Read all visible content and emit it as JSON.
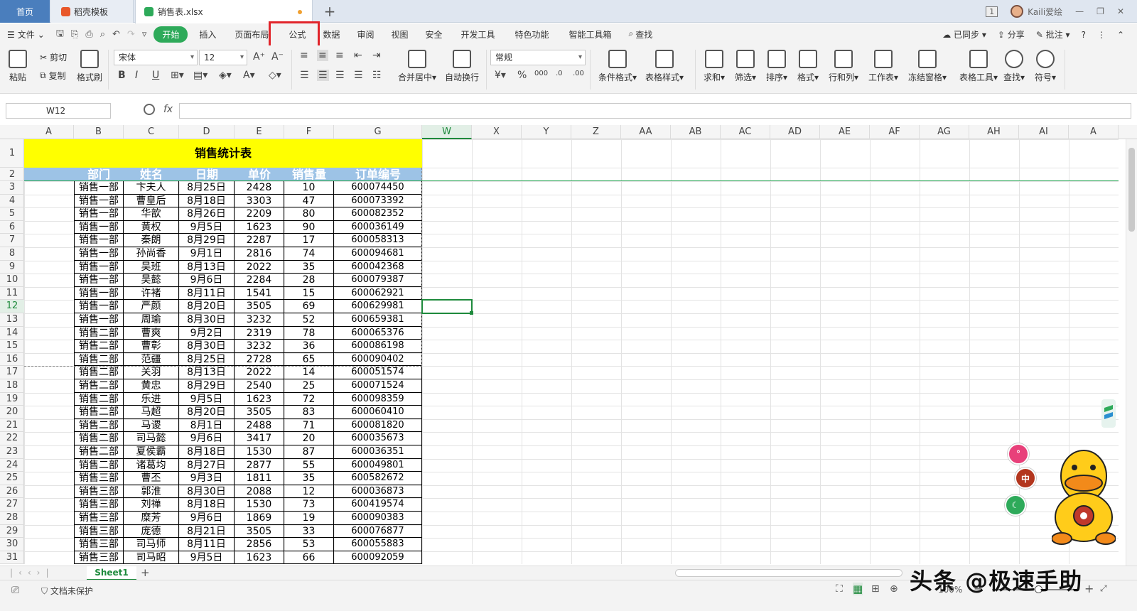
{
  "titlebar": {
    "tabs": [
      {
        "label": "首页"
      },
      {
        "label": "稻壳模板"
      },
      {
        "label": "销售表.xlsx"
      }
    ],
    "window_count": "1",
    "user": "Kaili爱绘"
  },
  "menu": {
    "file": "文件",
    "items": [
      "开始",
      "插入",
      "页面布局",
      "公式",
      "数据",
      "审阅",
      "视图",
      "安全",
      "开发工具",
      "特色功能",
      "智能工具箱"
    ],
    "search": "查找",
    "sync": "已同步",
    "share": "分享",
    "comment": "批注"
  },
  "ribbon": {
    "paste": "粘贴",
    "cut": "剪切",
    "copy": "复制",
    "format_painter": "格式刷",
    "font_name": "宋体",
    "font_size": "12",
    "merge": "合并居中",
    "wrap": "自动换行",
    "number_format": "常规",
    "cond_format": "条件格式",
    "table_style": "表格样式",
    "sum": "求和",
    "filter": "筛选",
    "sort": "排序",
    "format": "格式",
    "row_col": "行和列",
    "worksheet": "工作表",
    "freeze": "冻结窗格",
    "table_tools": "表格工具",
    "find": "查找",
    "symbol": "符号"
  },
  "formula_bar": {
    "name_box": "W12",
    "fx": "fx",
    "formula": ""
  },
  "sheet": {
    "columns": [
      "A",
      "B",
      "C",
      "D",
      "E",
      "F",
      "G",
      "W",
      "X",
      "Y",
      "Z",
      "AA",
      "AB",
      "AC",
      "AD",
      "AE",
      "AF",
      "AG",
      "AH",
      "AI",
      "A"
    ],
    "rows": [
      "1",
      "2",
      "3",
      "4",
      "5",
      "6",
      "7",
      "8",
      "9",
      "10",
      "11",
      "12",
      "13",
      "14",
      "15",
      "16",
      "17",
      "18",
      "19",
      "20",
      "21",
      "22",
      "23",
      "24",
      "25",
      "26",
      "27",
      "28",
      "29",
      "30",
      "31"
    ],
    "title": "销售统计表",
    "headers": [
      "部门",
      "姓名",
      "日期",
      "单价",
      "销售量",
      "订单编号"
    ],
    "data": [
      [
        "销售一部",
        "卞夫人",
        "8月25日",
        "2428",
        "10",
        "600074450"
      ],
      [
        "销售一部",
        "曹皇后",
        "8月18日",
        "3303",
        "47",
        "600073392"
      ],
      [
        "销售一部",
        "华歆",
        "8月26日",
        "2209",
        "80",
        "600082352"
      ],
      [
        "销售一部",
        "黄权",
        "9月5日",
        "1623",
        "90",
        "600036149"
      ],
      [
        "销售一部",
        "秦朗",
        "8月29日",
        "2287",
        "17",
        "600058313"
      ],
      [
        "销售一部",
        "孙尚香",
        "9月1日",
        "2816",
        "74",
        "600094681"
      ],
      [
        "销售一部",
        "吴班",
        "8月13日",
        "2022",
        "35",
        "600042368"
      ],
      [
        "销售一部",
        "吴懿",
        "9月6日",
        "2284",
        "28",
        "600079387"
      ],
      [
        "销售一部",
        "许褚",
        "8月11日",
        "1541",
        "15",
        "600062921"
      ],
      [
        "销售一部",
        "严颜",
        "8月20日",
        "3505",
        "69",
        "600629981"
      ],
      [
        "销售一部",
        "周瑜",
        "8月30日",
        "3232",
        "52",
        "600659381"
      ],
      [
        "销售二部",
        "曹爽",
        "9月2日",
        "2319",
        "78",
        "600065376"
      ],
      [
        "销售二部",
        "曹彰",
        "8月30日",
        "3232",
        "36",
        "600086198"
      ],
      [
        "销售二部",
        "范疆",
        "8月25日",
        "2728",
        "65",
        "600090402"
      ],
      [
        "销售二部",
        "关羽",
        "8月13日",
        "2022",
        "14",
        "600051574"
      ],
      [
        "销售二部",
        "黄忠",
        "8月29日",
        "2540",
        "25",
        "600071524"
      ],
      [
        "销售二部",
        "乐进",
        "9月5日",
        "1623",
        "72",
        "600098359"
      ],
      [
        "销售二部",
        "马超",
        "8月20日",
        "3505",
        "83",
        "600060410"
      ],
      [
        "销售二部",
        "马谡",
        "8月1日",
        "2488",
        "71",
        "600081820"
      ],
      [
        "销售二部",
        "司马懿",
        "9月6日",
        "3417",
        "20",
        "600035673"
      ],
      [
        "销售二部",
        "夏侯霸",
        "8月18日",
        "1530",
        "87",
        "600036351"
      ],
      [
        "销售二部",
        "诸葛均",
        "8月27日",
        "2877",
        "55",
        "600049801"
      ],
      [
        "销售三部",
        "曹丕",
        "9月3日",
        "1811",
        "35",
        "600582672"
      ],
      [
        "销售三部",
        "郭淮",
        "8月30日",
        "2088",
        "12",
        "600036873"
      ],
      [
        "销售三部",
        "刘禅",
        "8月18日",
        "1530",
        "73",
        "600419574"
      ],
      [
        "销售三部",
        "糜芳",
        "9月6日",
        "1869",
        "19",
        "600090383"
      ],
      [
        "销售三部",
        "庞德",
        "8月21日",
        "3505",
        "33",
        "600076877"
      ],
      [
        "销售三部",
        "司马师",
        "8月11日",
        "2856",
        "53",
        "600055883"
      ],
      [
        "销售三部",
        "司马昭",
        "9月5日",
        "1623",
        "66",
        "600092059"
      ]
    ]
  },
  "sheet_tabs": [
    "Sheet1"
  ],
  "status": {
    "protect": "文档未保护",
    "zoom": "100%"
  },
  "watermark": "头条 @极速手助",
  "floating": {
    "btn2": "中"
  },
  "colors": {
    "accent": "#2eaa5a",
    "title_fill": "#ffff00",
    "header_fill": "#9dc3e6",
    "highlight_box": "#e1242a"
  }
}
